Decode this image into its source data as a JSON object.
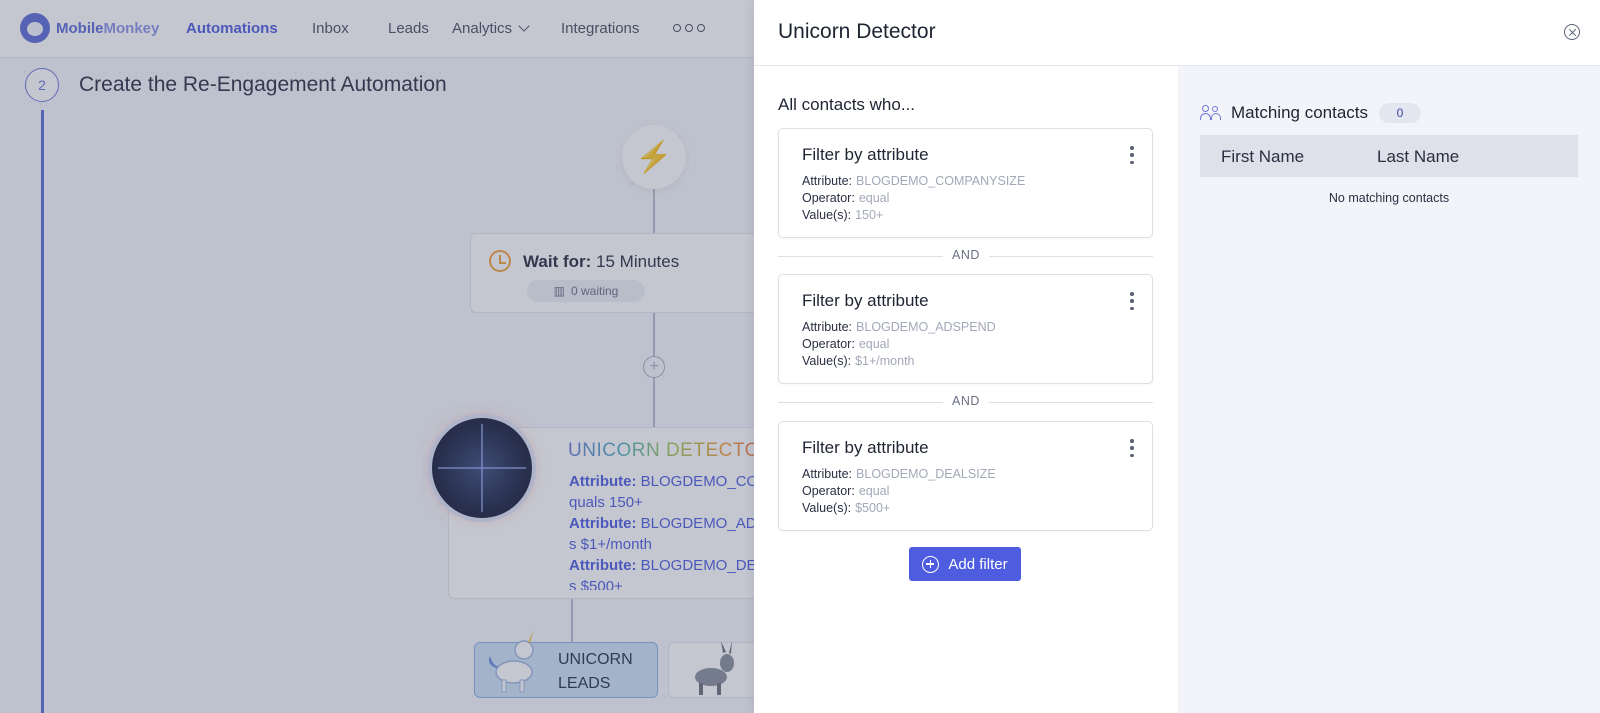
{
  "app": {
    "logo_text_1": "Mobile",
    "logo_text_2": "Monkey",
    "nav": {
      "automations": "Automations",
      "inbox": "Inbox",
      "leads": "Leads",
      "analytics": "Analytics",
      "integrations": "Integrations"
    },
    "step_number": "2",
    "step_title": "Create the Re-Engagement Automation",
    "wait": {
      "label": "Wait for:",
      "value": "15 Minutes",
      "waiting": "0 waiting"
    },
    "unicorn": {
      "title": "UNICORN DETECTOR",
      "lines": [
        {
          "key": "Attribute:",
          "text": "BLOGDEMO_COM"
        },
        {
          "key": "",
          "text": "quals 150+"
        },
        {
          "key": "Attribute:",
          "text": "BLOGDEMO_ADS"
        },
        {
          "key": "",
          "text": "s $1+/month"
        },
        {
          "key": "Attribute:",
          "text": "BLOGDEMO_DEA"
        },
        {
          "key": "",
          "text": "s $500+"
        }
      ]
    },
    "leads_label_1": "UNICORN",
    "leads_label_2": "LEADS"
  },
  "panel": {
    "title": "Unicorn Detector",
    "section_title": "All contacts who...",
    "filters": [
      {
        "title": "Filter by attribute",
        "attribute_label": "Attribute:",
        "attribute": "BLOGDEMO_COMPANYSIZE",
        "operator_label": "Operator:",
        "operator": "equal",
        "values_label": "Value(s):",
        "values": "150+"
      },
      {
        "title": "Filter by attribute",
        "attribute_label": "Attribute:",
        "attribute": "BLOGDEMO_ADSPEND",
        "operator_label": "Operator:",
        "operator": "equal",
        "values_label": "Value(s):",
        "values": "$1+/month"
      },
      {
        "title": "Filter by attribute",
        "attribute_label": "Attribute:",
        "attribute": "BLOGDEMO_DEALSIZE",
        "operator_label": "Operator:",
        "operator": "equal",
        "values_label": "Value(s):",
        "values": "$500+"
      }
    ],
    "and_label": "AND",
    "add_filter_label": "Add filter",
    "matching": {
      "title": "Matching contacts",
      "count": "0",
      "columns": [
        "First Name",
        "Last Name"
      ],
      "empty": "No matching contacts"
    }
  },
  "colors": {
    "accent": "#4e5de0",
    "overlay": "#464e6e",
    "muted_value": "#a3a8b8"
  }
}
